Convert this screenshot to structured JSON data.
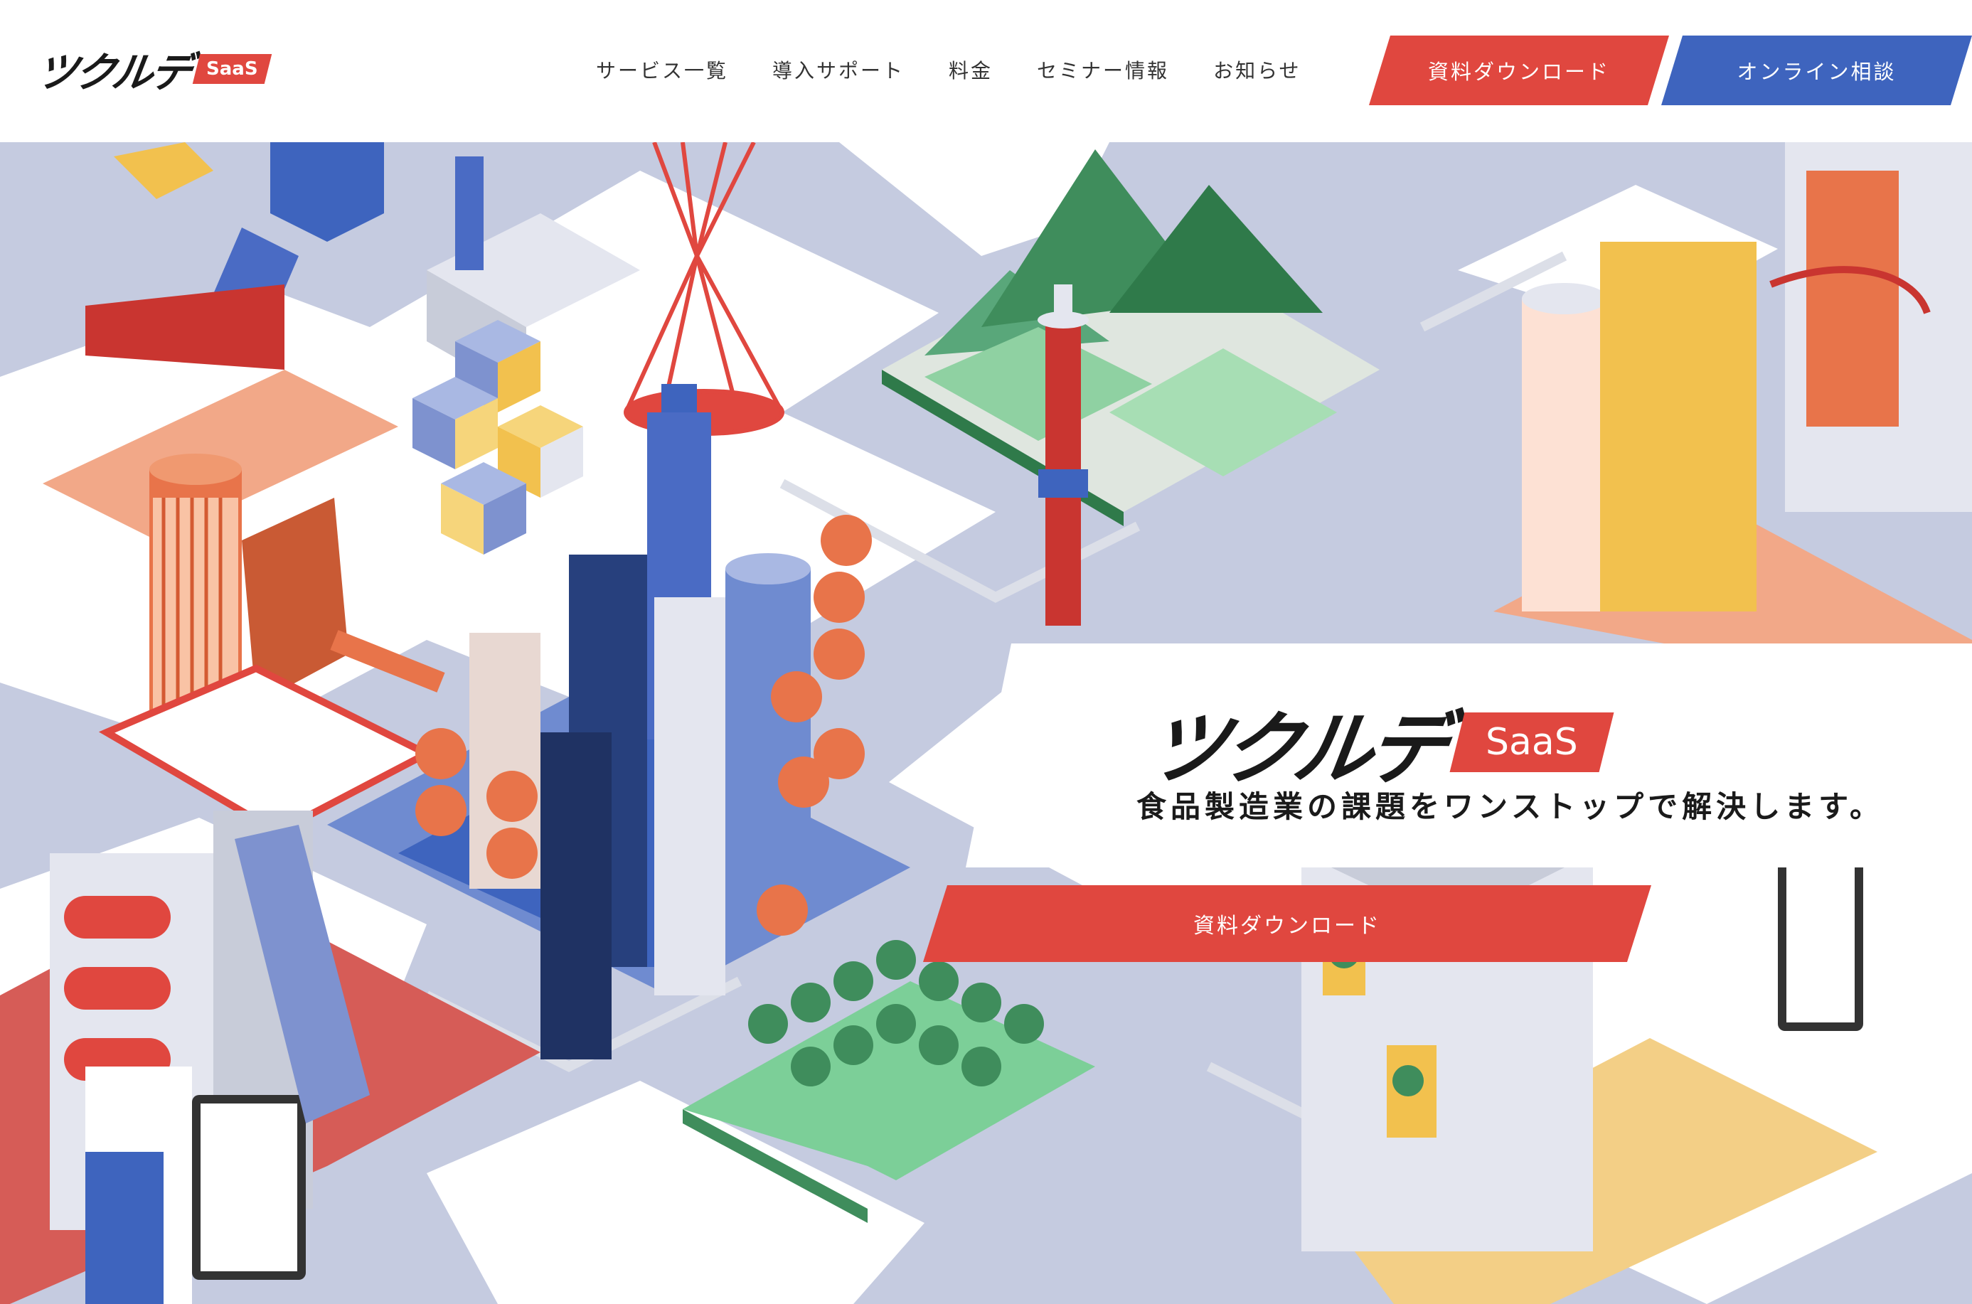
{
  "header": {
    "logo": {
      "mark": "ツクルデ",
      "badge": "SaaS"
    },
    "nav": [
      {
        "label": "サービス一覧"
      },
      {
        "label": "導入サポート"
      },
      {
        "label": "料金"
      },
      {
        "label": "セミナー情報"
      },
      {
        "label": "お知らせ"
      }
    ],
    "cta_download": "資料ダウンロード",
    "cta_consult": "オンライン相談"
  },
  "hero": {
    "logo": {
      "mark": "ツクルデ",
      "badge": "SaaS"
    },
    "tagline": "食品製造業の課題をワンストップで解決します。",
    "cta": "資料ダウンロード",
    "illustration": "isometric-food-factory-city"
  },
  "colors": {
    "accent_red": "#e0473f",
    "accent_blue": "#3e64be",
    "background_lavender": "#c5cbe0",
    "green": "#4aa86a",
    "orange": "#e8744a",
    "yellow": "#f2c14e"
  }
}
